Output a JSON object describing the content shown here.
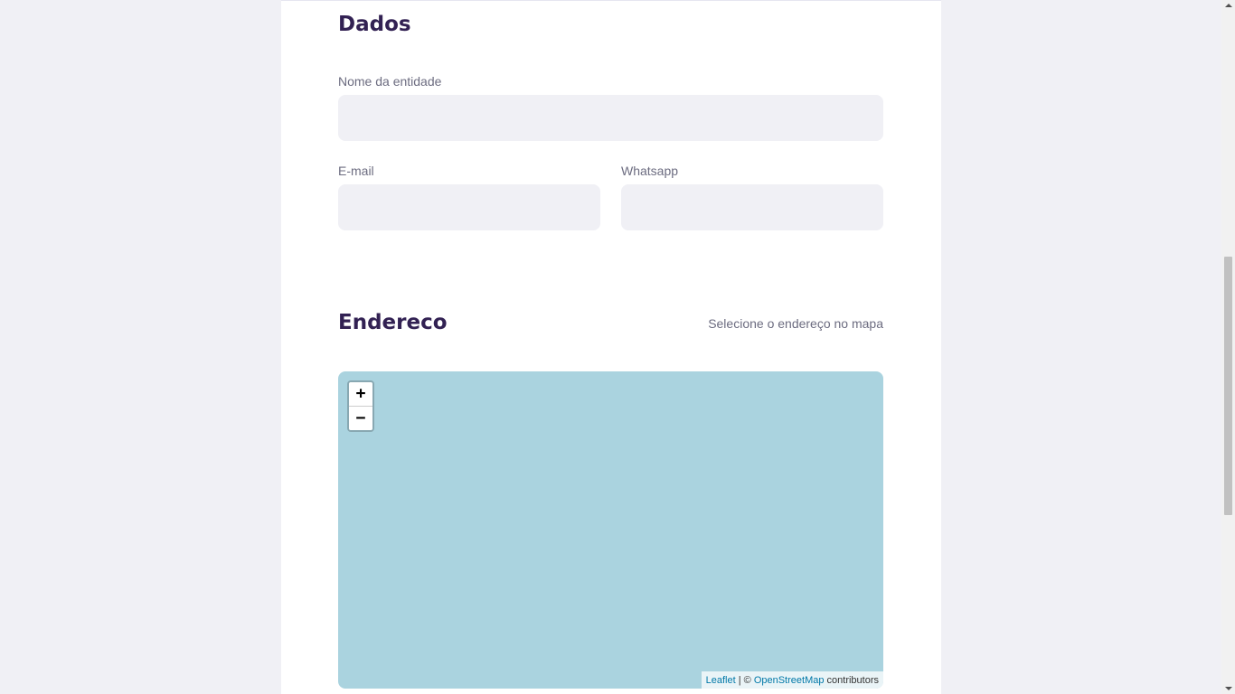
{
  "dados": {
    "title": "Dados",
    "nome": {
      "label": "Nome da entidade",
      "value": "",
      "placeholder": ""
    },
    "email": {
      "label": "E-mail",
      "value": "",
      "placeholder": ""
    },
    "whatsapp": {
      "label": "Whatsapp",
      "value": "",
      "placeholder": ""
    }
  },
  "endereco": {
    "title": "Endereco",
    "hint": "Selecione o endereço no mapa",
    "map": {
      "zoom_in": "+",
      "zoom_out": "−",
      "attribution": {
        "leaflet": "Leaflet",
        "separator": " | © ",
        "osm": "OpenStreetMap",
        "suffix": " contributors"
      },
      "background_color": "#aad3df"
    }
  },
  "colors": {
    "title": "#322153",
    "label": "#6c6c80",
    "input_bg": "#f0f0f5",
    "link": "#0078a8"
  }
}
